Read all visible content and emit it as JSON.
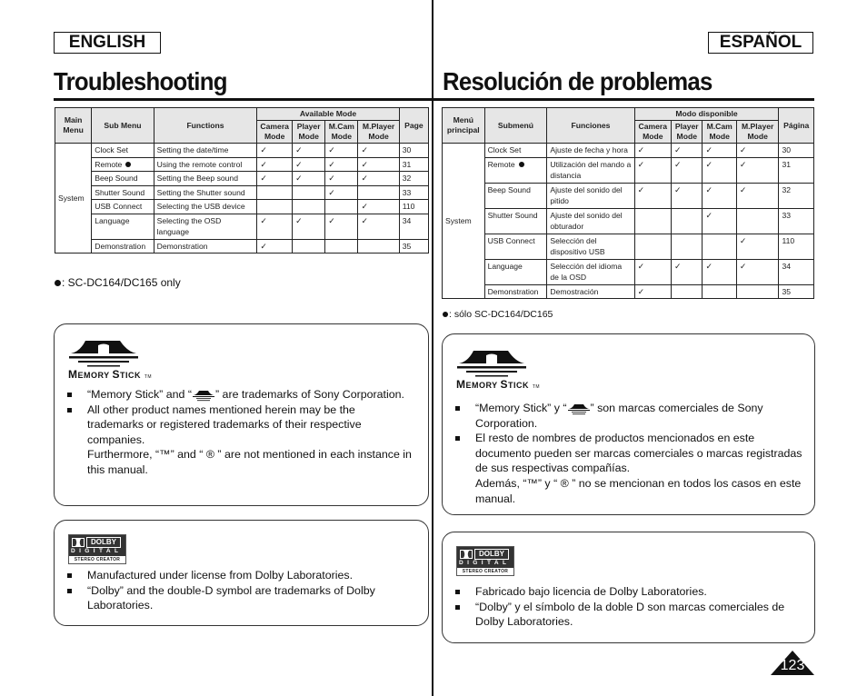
{
  "english": {
    "lang_label": "ENGLISH",
    "title": "Troubleshooting",
    "table": {
      "headers": {
        "main_menu": "Main Menu",
        "sub_menu": "Sub Menu",
        "functions": "Functions",
        "available_mode": "Available Mode",
        "modes": [
          "Camera Mode",
          "Player Mode",
          "M.Cam Mode",
          "M.Player Mode"
        ],
        "page": "Page"
      },
      "main_menu_value": "System",
      "rows": [
        {
          "sub": "Clock Set",
          "func": "Setting the date/time",
          "modes": [
            "✓",
            "✓",
            "✓",
            "✓"
          ],
          "page": "30"
        },
        {
          "sub": "Remote",
          "func": "Using the remote control",
          "modes": [
            "✓",
            "✓",
            "✓",
            "✓"
          ],
          "page": "31"
        },
        {
          "sub": "Beep Sound",
          "func": "Setting the Beep sound",
          "modes": [
            "✓",
            "✓",
            "✓",
            "✓"
          ],
          "page": "32"
        },
        {
          "sub": "Shutter Sound",
          "func": "Setting the Shutter sound",
          "modes": [
            "",
            "",
            "✓",
            ""
          ],
          "page": "33"
        },
        {
          "sub": "USB Connect",
          "func": "Selecting the USB device",
          "modes": [
            "",
            "",
            "",
            "✓"
          ],
          "page": "110"
        },
        {
          "sub": "Language",
          "func": "Selecting the OSD language",
          "modes": [
            "✓",
            "✓",
            "✓",
            "✓"
          ],
          "page": "34"
        },
        {
          "sub": "Demonstration",
          "func": "Demonstration",
          "modes": [
            "✓",
            "",
            "",
            ""
          ],
          "page": "35"
        }
      ]
    },
    "footnote": ": SC-DC164/DC165 only",
    "memory_stick": {
      "brand_cap1": "M",
      "brand_rest1": "EMORY ",
      "brand_cap2": "S",
      "brand_rest2": "TICK",
      "brand_tm": "TM",
      "note1_a": "“Memory Stick” and “",
      "note1_b": "” are trademarks of Sony Corporation.",
      "note2": "All other product names mentioned herein may be the trademarks or registered trademarks of their respective companies.",
      "note2_cont": "Furthermore, “™” and “ ® ” are not mentioned in each instance in this manual."
    },
    "dolby": {
      "logo_word": "DOLBY",
      "logo_digital": "DIGITAL",
      "logo_creator": "STEREO CREATOR",
      "notes": [
        "Manufactured under license from Dolby Laboratories.",
        "“Dolby” and the double-D symbol are trademarks of Dolby Laboratories."
      ]
    }
  },
  "spanish": {
    "lang_label": "ESPAÑOL",
    "title": "Resolución de problemas",
    "table": {
      "headers": {
        "main_menu": "Menú principal",
        "sub_menu": "Submenú",
        "functions": "Funciones",
        "available_mode": "Modo disponible",
        "modes": [
          "Camera Mode",
          "Player Mode",
          "M.Cam Mode",
          "M.Player Mode"
        ],
        "page": "Página"
      },
      "main_menu_value": "System",
      "rows": [
        {
          "sub": "Clock Set",
          "func": "Ajuste de fecha y hora",
          "modes": [
            "✓",
            "✓",
            "✓",
            "✓"
          ],
          "page": "30"
        },
        {
          "sub": "Remote",
          "func": "Utilización del mando a distancia",
          "modes": [
            "✓",
            "✓",
            "✓",
            "✓"
          ],
          "page": "31"
        },
        {
          "sub": "Beep Sound",
          "func": "Ajuste del sonido del pitido",
          "modes": [
            "✓",
            "✓",
            "✓",
            "✓"
          ],
          "page": "32"
        },
        {
          "sub": "Shutter Sound",
          "func": "Ajuste del sonido del obturador",
          "modes": [
            "",
            "",
            "✓",
            ""
          ],
          "page": "33"
        },
        {
          "sub": "USB Connect",
          "func": "Selección del dispositivo USB",
          "modes": [
            "",
            "",
            "",
            "✓"
          ],
          "page": "110"
        },
        {
          "sub": "Language",
          "func": "Selección del idioma de la OSD",
          "modes": [
            "✓",
            "✓",
            "✓",
            "✓"
          ],
          "page": "34"
        },
        {
          "sub": "Demonstration",
          "func": "Demostración",
          "modes": [
            "✓",
            "",
            "",
            ""
          ],
          "page": "35"
        }
      ]
    },
    "footnote": ": sólo SC-DC164/DC165",
    "memory_stick": {
      "brand_cap1": "M",
      "brand_rest1": "EMORY ",
      "brand_cap2": "S",
      "brand_rest2": "TICK",
      "brand_tm": "TM",
      "note1_a": "“Memory Stick” y “",
      "note1_b": "”  son marcas comerciales de Sony Corporation.",
      "note2": "El resto de nombres de productos mencionados en este documento pueden ser marcas comerciales o marcas registradas de sus respectivas compañías.",
      "note2_cont": "Además, “™” y “ ® ” no se mencionan en todos los casos en este manual."
    },
    "dolby": {
      "logo_word": "DOLBY",
      "logo_digital": "DIGITAL",
      "logo_creator": "STEREO CREATOR",
      "notes": [
        "Fabricado bajo licencia de Dolby Laboratories.",
        "“Dolby” y el símbolo de la doble D son marcas comerciales de Dolby Laboratories."
      ]
    }
  },
  "page_number": "123"
}
